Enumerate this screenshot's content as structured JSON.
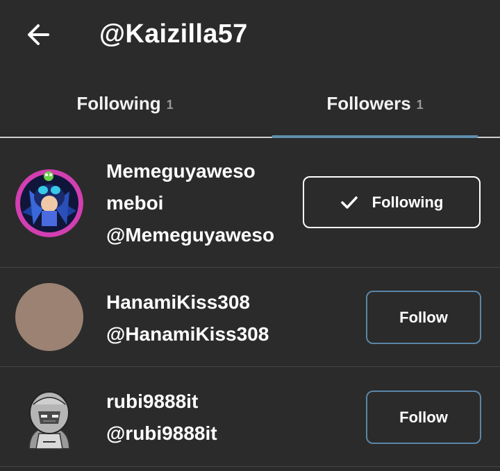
{
  "header": {
    "back_icon": "arrow-left-icon",
    "title": "@Kaizilla57"
  },
  "tabs": [
    {
      "label": "Following",
      "count": "1",
      "selected": false
    },
    {
      "label": "Followers",
      "count": "1",
      "selected": true
    }
  ],
  "colors": {
    "background": "#2b2b2b",
    "tab_indicator": "#5f8fb0",
    "follow_border": "#5a86a8",
    "text": "#ffffff"
  },
  "users": [
    {
      "name_line1": "Memeguyaweso",
      "name_line2": "meboi",
      "handle": "@Memeguyaweso",
      "button_label": "Following",
      "button_icon": "check-icon"
    },
    {
      "name": "HanamiKiss308",
      "handle": "@HanamiKiss308",
      "button_label": "Follow"
    },
    {
      "name": "rubi9888it",
      "handle": "@rubi9888it",
      "button_label": "Follow"
    }
  ]
}
